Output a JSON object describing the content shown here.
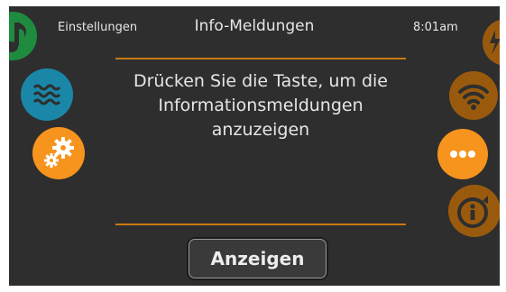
{
  "header": {
    "left_label": "Einstellungen",
    "title": "Info-Meldungen",
    "time": "8:01am"
  },
  "message": {
    "line1": "Drücken Sie die Taste, um die",
    "line2": "Informationsmeldungen",
    "line3": "anzuzeigen"
  },
  "button": {
    "label": "Anzeigen"
  },
  "icons": {
    "left": [
      "music-icon",
      "water-icon",
      "settings-icon"
    ],
    "right": [
      "power-icon",
      "wifi-icon",
      "more-icon",
      "info-icon"
    ]
  },
  "colors": {
    "background": "#2e2e2e",
    "accent_orange": "#f7941d",
    "dim_orange": "#9a5a0e",
    "music_green": "#1e8b3e",
    "water_blue": "#1a87a8",
    "divider": "#c87a12",
    "text": "#e6e6e6"
  }
}
